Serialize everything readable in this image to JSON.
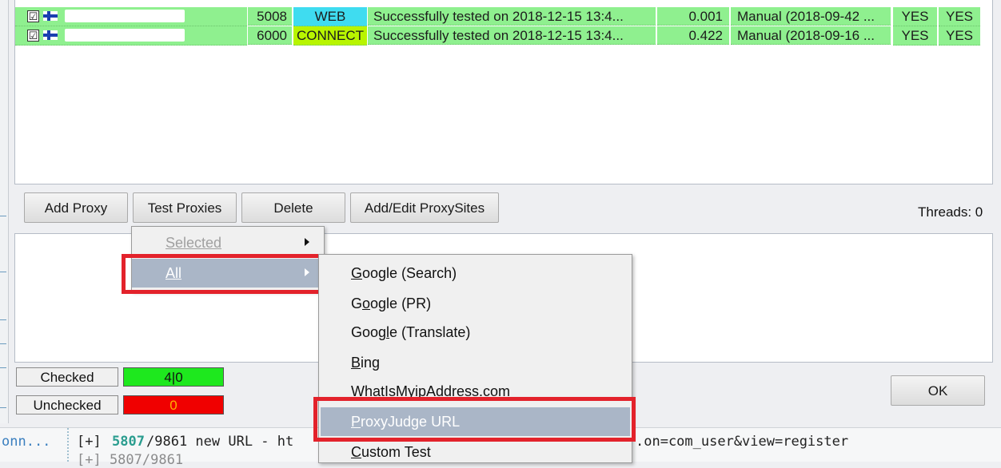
{
  "proxy_rows": [
    {
      "checked": "☑",
      "port": "5008",
      "type": "WEB",
      "type_color": "#3fdcf0",
      "status": "Successfully tested on 2018-12-15 13:4...",
      "speed": "0.001",
      "source": "Manual (2018-09-42 ...",
      "col1": "YES",
      "col2": "YES"
    },
    {
      "checked": "☑",
      "port": "6000",
      "type": "CONNECT",
      "type_color": "#b8f500",
      "status": "Successfully tested on 2018-12-15 13:4...",
      "speed": "0.422",
      "source": "Manual (2018-09-16 ...",
      "col1": "YES",
      "col2": "YES"
    }
  ],
  "toolbar": {
    "add_proxy": "Add Proxy",
    "test_proxies": "Test Proxies",
    "delete": "Delete",
    "add_edit_proxysites": "Add/Edit ProxySites",
    "threads": "Threads: 0"
  },
  "stats": {
    "checked_label": "Checked",
    "checked_value": "4|0",
    "checked_color": "#1ee81e",
    "unchecked_label": "Unchecked",
    "unchecked_value": "0",
    "unchecked_color": "#f00000"
  },
  "ok_button": "OK",
  "submenu_scope": {
    "selected": "Selected",
    "all": "All"
  },
  "submenu_tests": [
    {
      "label": "Google (Search)",
      "accel": "G"
    },
    {
      "label": "Google (PR)",
      "accel": "o"
    },
    {
      "label": "Google (Translate)",
      "accel": "l"
    },
    {
      "label": "Bing",
      "accel": "B"
    },
    {
      "label": "WhatIsMyipAddress.com",
      "accel": ""
    },
    {
      "label": "ProxyJudge URL",
      "accel": "P"
    },
    {
      "label": "Custom Test",
      "accel": "C"
    }
  ],
  "console": {
    "prefix": "onn...",
    "line1_tag": "[+]",
    "line1_count": "5807",
    "line1_total": "/9861 new URL - ht",
    "line1_tail": ".on=com_user&view=register",
    "line2_start": "[+] 5807/9861"
  },
  "colors": {
    "row_green": "#8ff08f",
    "highlight_red": "#e3222b",
    "menu_highlight": "#aab6c7",
    "console_count": "#2a9d8f"
  }
}
